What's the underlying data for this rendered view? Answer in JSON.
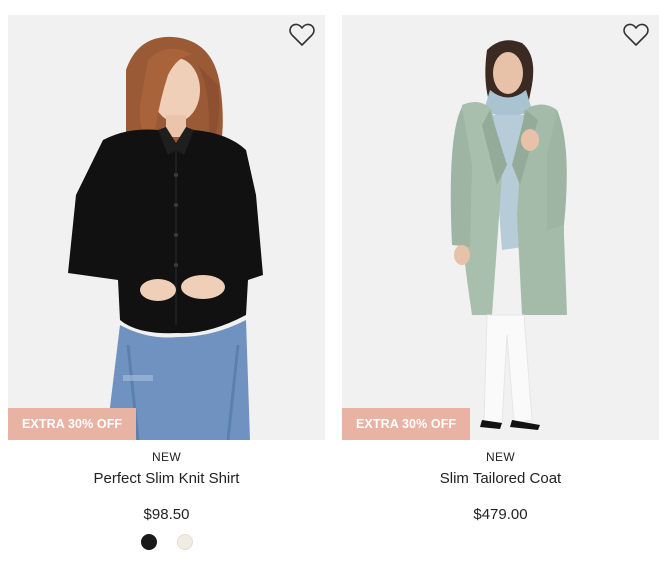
{
  "products": [
    {
      "badge": "EXTRA 30% OFF",
      "tag": "NEW",
      "name": "Perfect Slim Knit Shirt",
      "price": "$98.50",
      "swatches": [
        {
          "color": "#1a1a1a",
          "border": "#1a1a1a"
        },
        {
          "color": "#f1ece2",
          "border": "#e3ddd1"
        }
      ],
      "image_alt": "Model wearing black slim knit shirt with blue jeans"
    },
    {
      "badge": "EXTRA 30% OFF",
      "tag": "NEW",
      "name": "Slim Tailored Coat",
      "price": "$479.00",
      "image_alt": "Model wearing sage green tailored coat over light blue turtleneck with white trousers"
    }
  ],
  "icons": {
    "wishlist": "heart-outline-icon"
  },
  "colors": {
    "badge_bg": "#e8b3a2",
    "image_bg": "#f0f0f0"
  }
}
